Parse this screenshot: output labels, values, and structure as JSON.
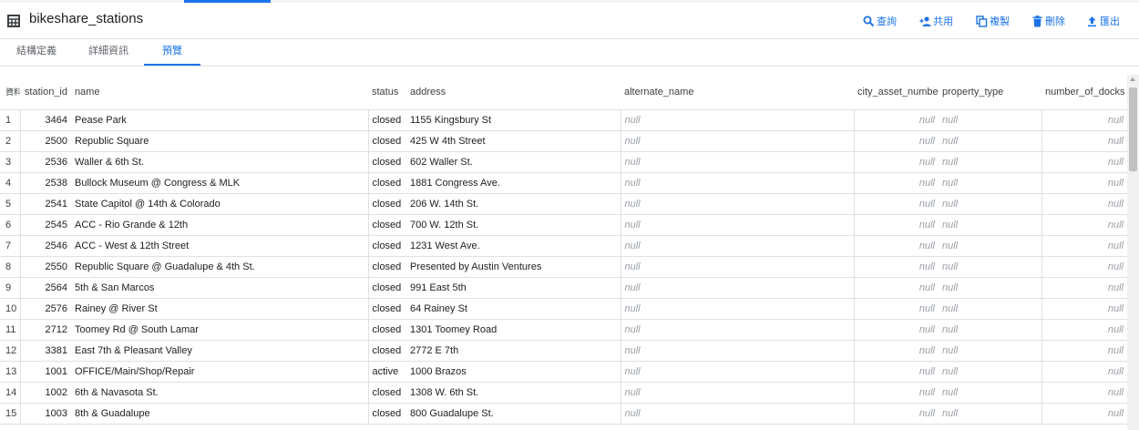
{
  "header": {
    "title": "bikeshare_stations",
    "actions": {
      "query": "查詢",
      "share": "共用",
      "copy": "複製",
      "delete": "刪除",
      "export": "匯出"
    }
  },
  "tabs": {
    "schema": "結構定義",
    "details": "詳細資訊",
    "preview": "預覽"
  },
  "colors": {
    "accent": "#1a73e8",
    "null_text": "#9aa0a6",
    "border": "#e0e0e0"
  },
  "table": {
    "row_header": "資料列",
    "columns": {
      "station_id": "station_id",
      "name": "name",
      "status": "status",
      "address": "address",
      "alternate_name": "alternate_name",
      "city_asset_number": "city_asset_number",
      "property_type": "property_type",
      "number_of_docks": "number_of_docks"
    },
    "rows": [
      {
        "n": "1",
        "station_id": "3464",
        "name": "Pease Park",
        "status": "closed",
        "address": "1155 Kingsbury St",
        "alternate_name": "null",
        "city_asset_number": "null",
        "property_type": "null",
        "number_of_docks": "null"
      },
      {
        "n": "2",
        "station_id": "2500",
        "name": "Republic Square",
        "status": "closed",
        "address": "425 W 4th Street",
        "alternate_name": "null",
        "city_asset_number": "null",
        "property_type": "null",
        "number_of_docks": "null"
      },
      {
        "n": "3",
        "station_id": "2536",
        "name": "Waller & 6th St.",
        "status": "closed",
        "address": "602 Waller St.",
        "alternate_name": "null",
        "city_asset_number": "null",
        "property_type": "null",
        "number_of_docks": "null"
      },
      {
        "n": "4",
        "station_id": "2538",
        "name": "Bullock Museum @ Congress & MLK",
        "status": "closed",
        "address": "1881 Congress Ave.",
        "alternate_name": "null",
        "city_asset_number": "null",
        "property_type": "null",
        "number_of_docks": "null"
      },
      {
        "n": "5",
        "station_id": "2541",
        "name": "State Capitol @ 14th & Colorado",
        "status": "closed",
        "address": "206 W. 14th St.",
        "alternate_name": "null",
        "city_asset_number": "null",
        "property_type": "null",
        "number_of_docks": "null"
      },
      {
        "n": "6",
        "station_id": "2545",
        "name": "ACC - Rio Grande & 12th",
        "status": "closed",
        "address": "700 W. 12th St.",
        "alternate_name": "null",
        "city_asset_number": "null",
        "property_type": "null",
        "number_of_docks": "null"
      },
      {
        "n": "7",
        "station_id": "2546",
        "name": "ACC - West & 12th Street",
        "status": "closed",
        "address": "1231 West Ave.",
        "alternate_name": "null",
        "city_asset_number": "null",
        "property_type": "null",
        "number_of_docks": "null"
      },
      {
        "n": "8",
        "station_id": "2550",
        "name": "Republic Square @ Guadalupe & 4th St.",
        "status": "closed",
        "address": "Presented by Austin Ventures",
        "alternate_name": "null",
        "city_asset_number": "null",
        "property_type": "null",
        "number_of_docks": "null"
      },
      {
        "n": "9",
        "station_id": "2564",
        "name": "5th & San Marcos",
        "status": "closed",
        "address": "991 East 5th",
        "alternate_name": "null",
        "city_asset_number": "null",
        "property_type": "null",
        "number_of_docks": "null"
      },
      {
        "n": "10",
        "station_id": "2576",
        "name": "Rainey @ River St",
        "status": "closed",
        "address": "64 Rainey St",
        "alternate_name": "null",
        "city_asset_number": "null",
        "property_type": "null",
        "number_of_docks": "null"
      },
      {
        "n": "11",
        "station_id": "2712",
        "name": "Toomey Rd @ South Lamar",
        "status": "closed",
        "address": "1301 Toomey Road",
        "alternate_name": "null",
        "city_asset_number": "null",
        "property_type": "null",
        "number_of_docks": "null"
      },
      {
        "n": "12",
        "station_id": "3381",
        "name": "East 7th & Pleasant Valley",
        "status": "closed",
        "address": "2772 E 7th",
        "alternate_name": "null",
        "city_asset_number": "null",
        "property_type": "null",
        "number_of_docks": "null"
      },
      {
        "n": "13",
        "station_id": "1001",
        "name": "OFFICE/Main/Shop/Repair",
        "status": "active",
        "address": "1000 Brazos",
        "alternate_name": "null",
        "city_asset_number": "null",
        "property_type": "null",
        "number_of_docks": "null"
      },
      {
        "n": "14",
        "station_id": "1002",
        "name": "6th & Navasota St.",
        "status": "closed",
        "address": "1308 W. 6th St.",
        "alternate_name": "null",
        "city_asset_number": "null",
        "property_type": "null",
        "number_of_docks": "null"
      },
      {
        "n": "15",
        "station_id": "1003",
        "name": "8th & Guadalupe",
        "status": "closed",
        "address": "800 Guadalupe St.",
        "alternate_name": "null",
        "city_asset_number": "null",
        "property_type": "null",
        "number_of_docks": "null"
      }
    ]
  }
}
